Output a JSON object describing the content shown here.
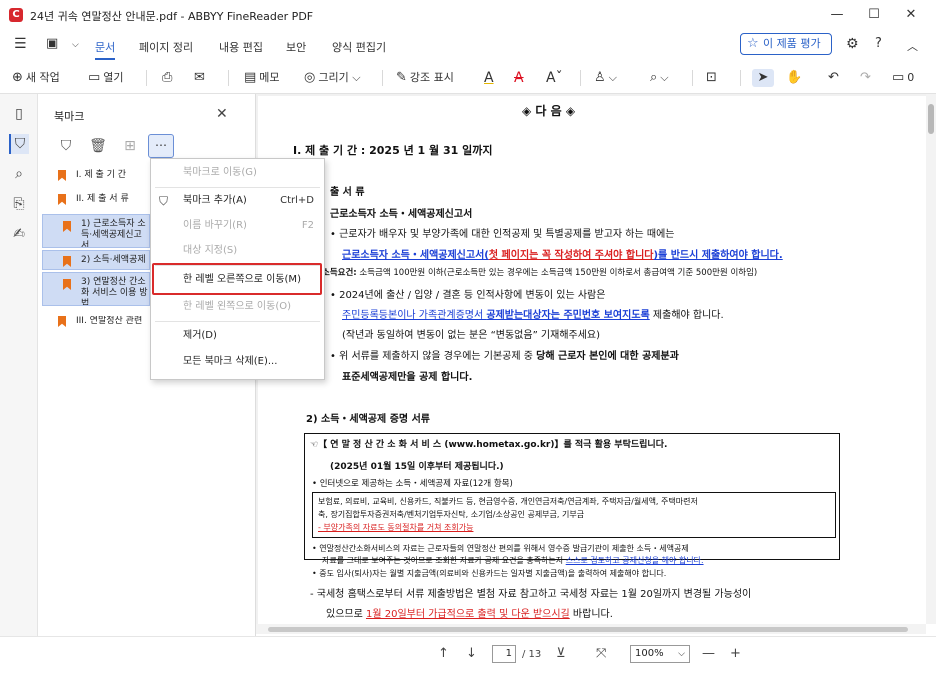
{
  "window": {
    "title": "24년 귀속 연말정산 안내문.pdf - ABBYY FineReader PDF",
    "minimize": "—",
    "maximize": "☐",
    "close": "✕"
  },
  "ribbon": {
    "tabs": [
      "문서",
      "페이지 정리",
      "내용 편집",
      "보안",
      "양식 편집기"
    ],
    "rate_button": "이 제품 평가"
  },
  "toolbar": {
    "new_task": "새 작업",
    "open": "열기",
    "memo": "메모",
    "draw": "그리기",
    "highlight": "강조 표시",
    "comment_count": "0"
  },
  "bookmarks": {
    "header": "북마크",
    "items": [
      {
        "label": "I. 제 출 기 간"
      },
      {
        "label": "II. 제 출 서 류"
      },
      {
        "label": "1) 근로소득자 소득·세액공제신고서"
      },
      {
        "label": "2) 소득·세액공제"
      },
      {
        "label": "3) 연말정산 간소화 서비스 이용 방법"
      },
      {
        "label": "III. 연말정산 관련"
      }
    ]
  },
  "context_menu": {
    "items": [
      {
        "label": "북마크로 이동(G)",
        "shortcut": ""
      },
      {
        "label": "북마크 추가(A)",
        "shortcut": "Ctrl+D"
      },
      {
        "label": "이름 바꾸기(R)",
        "shortcut": "F2"
      },
      {
        "label": "대상 지정(S)",
        "shortcut": ""
      },
      {
        "label": "한 레벨 오른쪽으로 이동(M)",
        "shortcut": ""
      },
      {
        "label": "한 레벨 왼쪽으로 이동(O)",
        "shortcut": ""
      },
      {
        "label": "제거(D)",
        "shortcut": ""
      },
      {
        "label": "모든 북마크 삭제(E)...",
        "shortcut": ""
      }
    ]
  },
  "document": {
    "heading": "◈  다        음  ◈",
    "s1": "I. 제 출 기 간  :  2025 년   1 월   31 일까지",
    "s2": "출 서 류",
    "s2_1": "근로소득자 소득・세액공제신고서",
    "l1": "• 근로자가 배우자 및 부양가족에 대한 인적공제 및 특별공제를 받고자 하는 때에는",
    "l2a": "근로소득자 소득・세액공제신고서(",
    "l2b": "첫 페이지는 꼭 작성하여 주셔야 합니다",
    "l2c": ")를 반드시 제출하여야 합니다.",
    "l3a": "소득요건:",
    "l3b": " 소득금액 100만원 이하(근로소득만 있는 경우에는 소득금액 150만원 이하로서 총급여액 기준 500만원 이하임)",
    "l4": "• 2024년에 출산 / 입양 / 결혼 등 인적사항에 변동이 있는 사람은",
    "l5a": "주민등록등본이나 가족관계증명서 ",
    "l5b": "공제받는대상자는 주민번호 보여지도록",
    "l5c": " 제출해야 합니다.",
    "l6": "(작년과 동일하여 변동이 없는 분은 “변동없음” 기재해주세요)",
    "l7a": "• 위 서류를 제출하지 않을 경우에는 기본공제 중 ",
    "l7b": "당해 근로자 본인에 대한 공제분과",
    "l8": "표준세액공제만을 공제 합니다.",
    "s2_2": "2) 소득・세액공제 증명 서류",
    "b1": "☜【 연 말 정 산 간 소 화 서 비 스  (www.hometax.go.kr)】를  적극 활용 부탁드립니다.",
    "b2": "(2025년 01월 15일 이후부터 제공됩니다.)",
    "b3": "• 인터넷으로 제공하는 소득・세액공제 자료(12개 항목)",
    "b4": "보험료, 의료비, 교육비, 신용카드, 직불카드 등, 현금영수증, 개인연금저축/연금계좌, 주택자금/월세액, 주택마련저",
    "b5": "축, 장기집합투자증권저축/벤처기업투자신탁, 소기업/소상공인 공제부금, 기부금",
    "b6": "- 부양가족의 자료도 동의절차를 거쳐 조회가능",
    "b7": "• 연말정산간소화서비스의 자료는 근로자들의 연말정산 편의를 위해서 영수증 발급기관이 제출한 소득・세액공제",
    "b8a": "자료를 그대로 보여주는 것이므로 조회한 자료가 공제 요건을 충족하는지 ",
    "b8b": "스스로 검토하고 공제신청을 해야 합니다.",
    "b9": "• 중도 입사(퇴사)자는 월별 지출금액(의료비와 신용카드는 일자별 지출금액)을 출력하여 제출해야 합니다.",
    "n1": "- 국세청 홈택스로부터 서류 제출방법은 별첨 자료 참고하고 국세청 자료는 1월 20일까지 변경될 가능성이",
    "n2a": "있으므로 ",
    "n2b": "1월 20일부터 가급적으로 출력 및 다운 받으시길",
    "n2c": " 바랍니다."
  },
  "statusbar": {
    "page_current": "1",
    "page_total": "/ 13",
    "zoom": "100%"
  },
  "colors": {
    "accent": "#2b62c8",
    "highlight_border": "#d92b2b",
    "bookmark_flag": "#e8711a"
  }
}
